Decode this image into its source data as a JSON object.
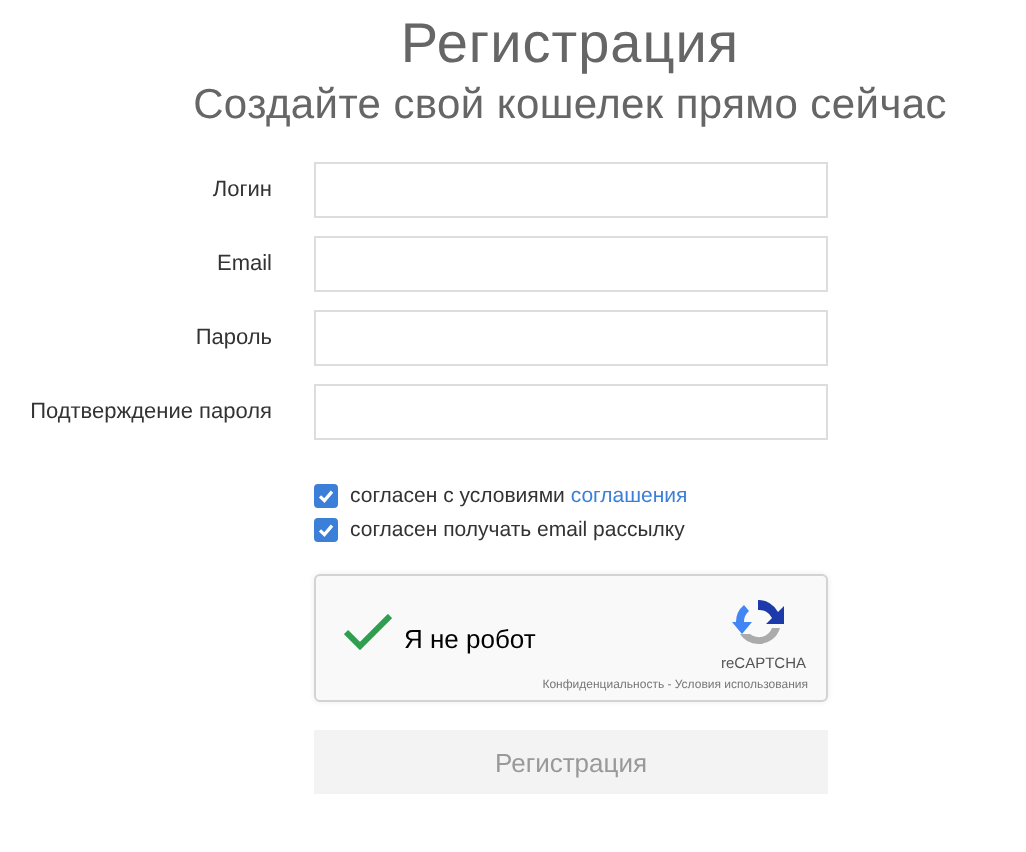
{
  "header": {
    "title": "Регистрация",
    "subtitle": "Создайте свой кошелек прямо сейчас"
  },
  "fields": [
    {
      "label": "Логин"
    },
    {
      "label": "Email"
    },
    {
      "label": "Пароль"
    },
    {
      "label": "Подтверждение пароля"
    }
  ],
  "agreements": [
    {
      "text": "согласен с условиями",
      "link": "соглашения",
      "checked": true
    },
    {
      "text": "согласен получать email рассылку",
      "checked": true
    }
  ],
  "captcha": {
    "label": "Я не робот",
    "checked": true,
    "brand": "reCAPTCHA",
    "footer": "Конфиденциальность - Условия использования"
  },
  "submit": {
    "label": "Регистрация",
    "disabled": true
  }
}
